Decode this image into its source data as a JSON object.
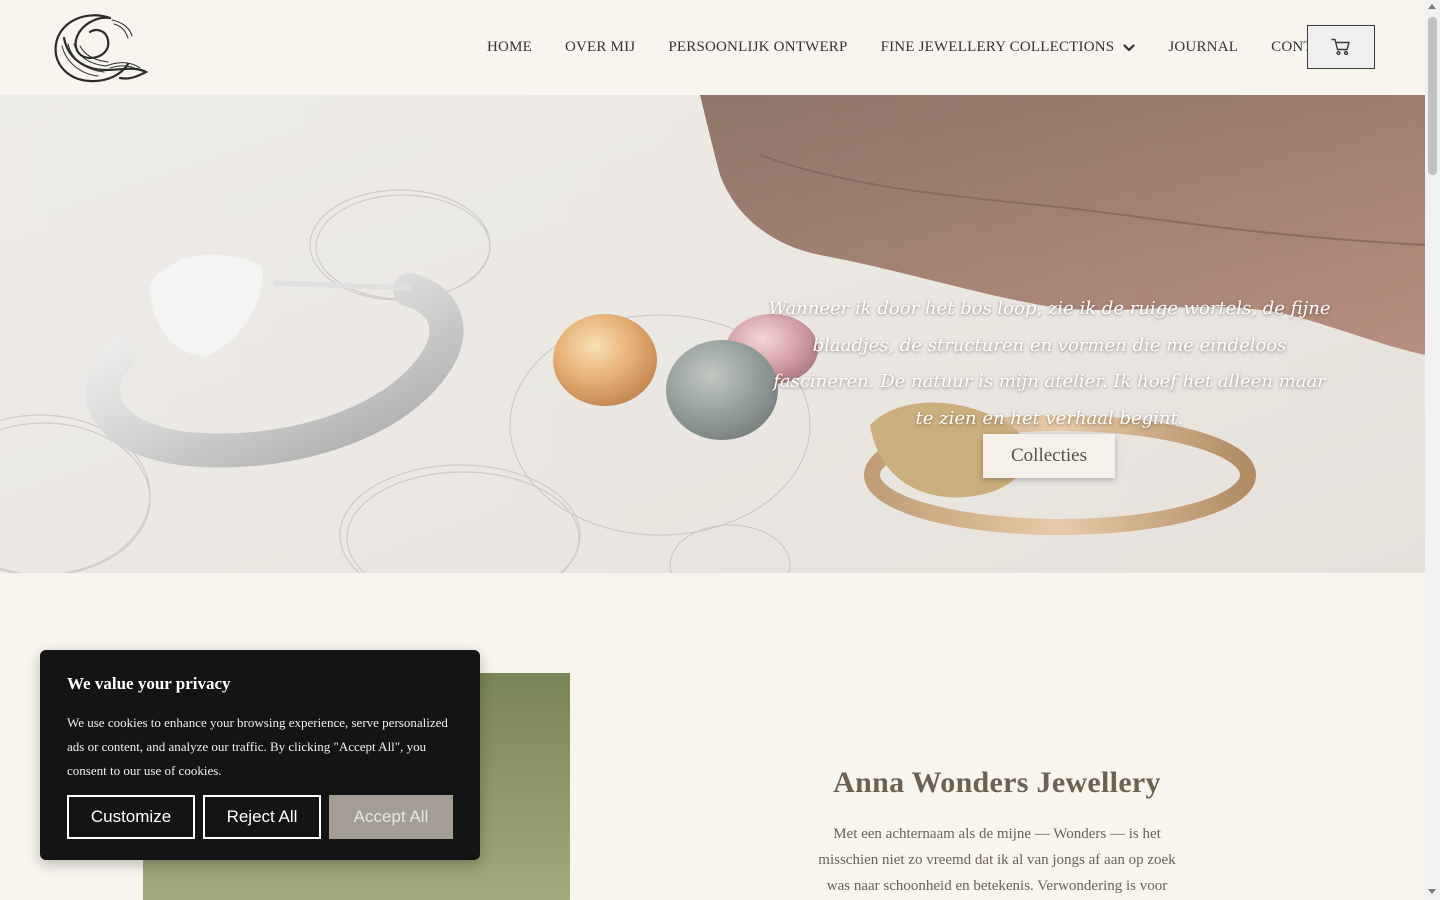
{
  "brand": {
    "logo_icon": "wave-swirl-logo-icon"
  },
  "nav": {
    "items": [
      {
        "label": "HOME"
      },
      {
        "label": "OVER MIJ"
      },
      {
        "label": "PERSOONLIJK ONTWERP"
      },
      {
        "label": "FINE JEWELLERY COLLECTIONS",
        "icon": "chevron-down-icon"
      },
      {
        "label": "JOURNAL"
      },
      {
        "label": "CONTACT"
      }
    ],
    "cart_icon": "shopping-cart-icon"
  },
  "hero": {
    "quote": "Wanneer ik door het bos loop, zie ik de ruige wortels, de fijne blaadjes, de structuren en vormen die me eindeloos fascineren. De natuur is mijn atelier. Ik hoef het alleen maar te zien en het verhaal begint.",
    "button_label": "Collecties"
  },
  "intro": {
    "title": "Anna Wonders Jewellery",
    "text": "Met een achternaam als de mijne — Wonders — is het misschien niet zo vreemd dat ik al van jongs af aan op zoek was naar schoonheid en betekenis. Verwondering is voor"
  },
  "cookie": {
    "title": "We value your privacy",
    "text": "We use cookies to enhance your browsing experience, serve personalized ads or content, and analyze our traffic. By clicking \"Accept All\", you consent to our use of cookies.",
    "customize_label": "Customize",
    "reject_label": "Reject All",
    "accept_label": "Accept All"
  },
  "colors": {
    "page_bg": "#f8f5ee",
    "text_brown": "#6d6152",
    "cookie_bg": "#141414",
    "accept_button": "#a39d94"
  }
}
